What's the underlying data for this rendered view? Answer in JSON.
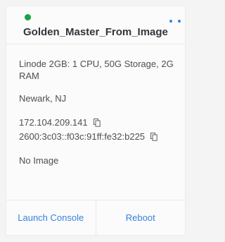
{
  "card": {
    "title": "Golden_Master_From_Image",
    "status_color": "#17a343",
    "accent_color": "#3683dc",
    "menu_icon": "more-horizontal-icon",
    "plan": "Linode 2GB: 1 CPU, 50G Storage, 2G RAM",
    "region": "Newark, NJ",
    "ipv4": "172.104.209.141",
    "ipv6": "2600:3c03::f03c:91ff:fe32:b225",
    "copy_icon": "copy-icon",
    "image": "No Image"
  },
  "footer": {
    "launch_console_label": "Launch Console",
    "reboot_label": "Reboot"
  }
}
